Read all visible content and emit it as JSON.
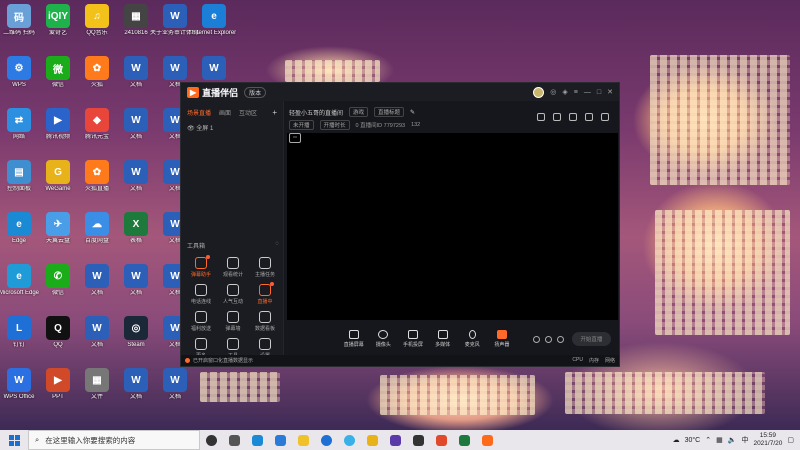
{
  "desktop": {
    "icons": [
      {
        "label": "二维码\n扫码",
        "color": "#6aa0d8",
        "glyph": "码",
        "col": 0,
        "row": 0
      },
      {
        "label": "爱奇艺",
        "color": "#1db34a",
        "glyph": "iQIY",
        "col": 1,
        "row": 0
      },
      {
        "label": "QQ音乐",
        "color": "#f2c21a",
        "glyph": "♫",
        "col": 2,
        "row": 0
      },
      {
        "label": "2410816",
        "color": "#444",
        "glyph": "▦",
        "col": 3,
        "row": 0
      },
      {
        "label": "关于业务审计体制...2023",
        "color": "#2b5fb8",
        "glyph": "W",
        "col": 4,
        "row": 0
      },
      {
        "label": "Internet Explorer",
        "color": "#1b7fd8",
        "glyph": "e",
        "col": 5,
        "row": 0
      },
      {
        "label": "WPS",
        "color": "#2c7be5",
        "glyph": "⚙",
        "col": 0,
        "row": 1
      },
      {
        "label": "微信",
        "color": "#1aad19",
        "glyph": "微",
        "col": 1,
        "row": 1
      },
      {
        "label": "火狐",
        "color": "#ff7a1a",
        "glyph": "✿",
        "col": 2,
        "row": 1
      },
      {
        "label": "文档",
        "color": "#2b5fb8",
        "glyph": "W",
        "col": 3,
        "row": 1
      },
      {
        "label": "文档",
        "color": "#2b5fb8",
        "glyph": "W",
        "col": 4,
        "row": 1
      },
      {
        "label": "文档",
        "color": "#2b5fb8",
        "glyph": "W",
        "col": 5,
        "row": 1
      },
      {
        "label": "网络",
        "color": "#2d8fe0",
        "glyph": "⇄",
        "col": 0,
        "row": 2
      },
      {
        "label": "腾讯视频",
        "color": "#2a63c9",
        "glyph": "▶",
        "col": 1,
        "row": 2
      },
      {
        "label": "腾讯元宝",
        "color": "#e8463a",
        "glyph": "◆",
        "col": 2,
        "row": 2
      },
      {
        "label": "文档",
        "color": "#2b5fb8",
        "glyph": "W",
        "col": 3,
        "row": 2
      },
      {
        "label": "文档",
        "color": "#2b5fb8",
        "glyph": "W",
        "col": 4,
        "row": 2
      },
      {
        "label": "控制面板",
        "color": "#3e8ed0",
        "glyph": "▤",
        "col": 0,
        "row": 3
      },
      {
        "label": "WeGame",
        "color": "#e8b21a",
        "glyph": "G",
        "col": 1,
        "row": 3
      },
      {
        "label": "火狐直播",
        "color": "#ff7a1a",
        "glyph": "✿",
        "col": 2,
        "row": 3
      },
      {
        "label": "文档",
        "color": "#2b5fb8",
        "glyph": "W",
        "col": 3,
        "row": 3
      },
      {
        "label": "文档",
        "color": "#2b5fb8",
        "glyph": "W",
        "col": 4,
        "row": 3
      },
      {
        "label": "Edge",
        "color": "#1a8ad4",
        "glyph": "e",
        "col": 0,
        "row": 4
      },
      {
        "label": "天翼云盘",
        "color": "#4a9ee8",
        "glyph": "✈",
        "col": 1,
        "row": 4
      },
      {
        "label": "百度网盘",
        "color": "#3a8ee6",
        "glyph": "☁",
        "col": 2,
        "row": 4
      },
      {
        "label": "表格",
        "color": "#1e7a3c",
        "glyph": "X",
        "col": 3,
        "row": 4
      },
      {
        "label": "文档",
        "color": "#2b5fb8",
        "glyph": "W",
        "col": 4,
        "row": 4
      },
      {
        "label": "Microsoft Edge",
        "color": "#1f9bd8",
        "glyph": "e",
        "col": 0,
        "row": 5
      },
      {
        "label": "微信",
        "color": "#1aad19",
        "glyph": "✆",
        "col": 1,
        "row": 5
      },
      {
        "label": "文档",
        "color": "#2b5fb8",
        "glyph": "W",
        "col": 2,
        "row": 5
      },
      {
        "label": "文档",
        "color": "#2b5fb8",
        "glyph": "W",
        "col": 3,
        "row": 5
      },
      {
        "label": "文档",
        "color": "#2b5fb8",
        "glyph": "W",
        "col": 4,
        "row": 5
      },
      {
        "label": "钉钉",
        "color": "#1e70d6",
        "glyph": "L",
        "col": 0,
        "row": 6
      },
      {
        "label": "QQ",
        "color": "#111",
        "glyph": "Q",
        "col": 1,
        "row": 6
      },
      {
        "label": "文档",
        "color": "#2b5fb8",
        "glyph": "W",
        "col": 2,
        "row": 6
      },
      {
        "label": "Steam",
        "color": "#1b2838",
        "glyph": "◎",
        "col": 3,
        "row": 6
      },
      {
        "label": "文档",
        "color": "#2b5fb8",
        "glyph": "W",
        "col": 4,
        "row": 6
      },
      {
        "label": "WPS Office",
        "color": "#2c6fe0",
        "glyph": "W",
        "col": 0,
        "row": 7
      },
      {
        "label": "PPT",
        "color": "#d04a2a",
        "glyph": "▶",
        "col": 1,
        "row": 7
      },
      {
        "label": "文件",
        "color": "#777",
        "glyph": "▦",
        "col": 2,
        "row": 7
      },
      {
        "label": "文档",
        "color": "#2b5fb8",
        "glyph": "W",
        "col": 3,
        "row": 7
      },
      {
        "label": "文档",
        "color": "#2b5fb8",
        "glyph": "W",
        "col": 4,
        "row": 7
      }
    ]
  },
  "app": {
    "logo": "直播伴侣",
    "version": "版本",
    "left_tabs": [
      "场景直播",
      "画面",
      "互动区"
    ],
    "scene_label": "全屏 1",
    "tools_title": "工具箱",
    "tools": [
      {
        "label": "弹幕助手",
        "orange": true,
        "dot": true
      },
      {
        "label": "观看统计",
        "orange": false,
        "dot": false
      },
      {
        "label": "主播任务",
        "orange": false,
        "dot": false
      },
      {
        "label": "电话连线",
        "orange": false,
        "dot": false
      },
      {
        "label": "人气互动",
        "orange": false,
        "dot": false
      },
      {
        "label": "直播中",
        "orange": true,
        "dot": true
      },
      {
        "label": "福利放送",
        "orange": false,
        "dot": false
      },
      {
        "label": "弹幕墙",
        "orange": false,
        "dot": false
      },
      {
        "label": "数据看板",
        "orange": false,
        "dot": false
      },
      {
        "label": "更多",
        "orange": false,
        "dot": false
      },
      {
        "label": "工具",
        "orange": false,
        "dot": false
      },
      {
        "label": "设置",
        "orange": false,
        "dot": false
      }
    ],
    "room_title": "轻盈小五哥的直播间",
    "room_tag": "游戏",
    "room_field": "直播标题",
    "room_status1": "未开播",
    "room_status2": "开播时长",
    "room_meta": "0  直播间ID  7797293",
    "room_likes": "132",
    "bottom_buttons": [
      "直播屏幕",
      "摄像头",
      "手机投屏",
      "多媒体",
      "麦克风",
      "扬声器"
    ],
    "live_button": "开始直播",
    "status_text": "已开启窗口化直播数据显示",
    "status_right": [
      "CPU",
      "内存",
      "网络"
    ]
  },
  "taskbar": {
    "search_placeholder": "在这里输入你要搜索的内容",
    "apps": [
      {
        "color": "#333",
        "shape": "circle"
      },
      {
        "color": "#555",
        "shape": "square"
      },
      {
        "color": "#1b8ad6",
        "shape": "square"
      },
      {
        "color": "#2a7bd8",
        "shape": "square"
      },
      {
        "color": "#f0c22a",
        "shape": "square"
      },
      {
        "color": "#1e70d6",
        "shape": "circle"
      },
      {
        "color": "#3ab0e8",
        "shape": "circle"
      },
      {
        "color": "#e8b21a",
        "shape": "square"
      },
      {
        "color": "#5a3aa8",
        "shape": "square"
      },
      {
        "color": "#333",
        "shape": "square"
      },
      {
        "color": "#e04a2a",
        "shape": "square"
      },
      {
        "color": "#1e7a3c",
        "shape": "square"
      },
      {
        "color": "#ff6a1a",
        "shape": "square"
      }
    ],
    "temperature": "30°C",
    "time": "15:59",
    "date": "2021/7/20"
  }
}
